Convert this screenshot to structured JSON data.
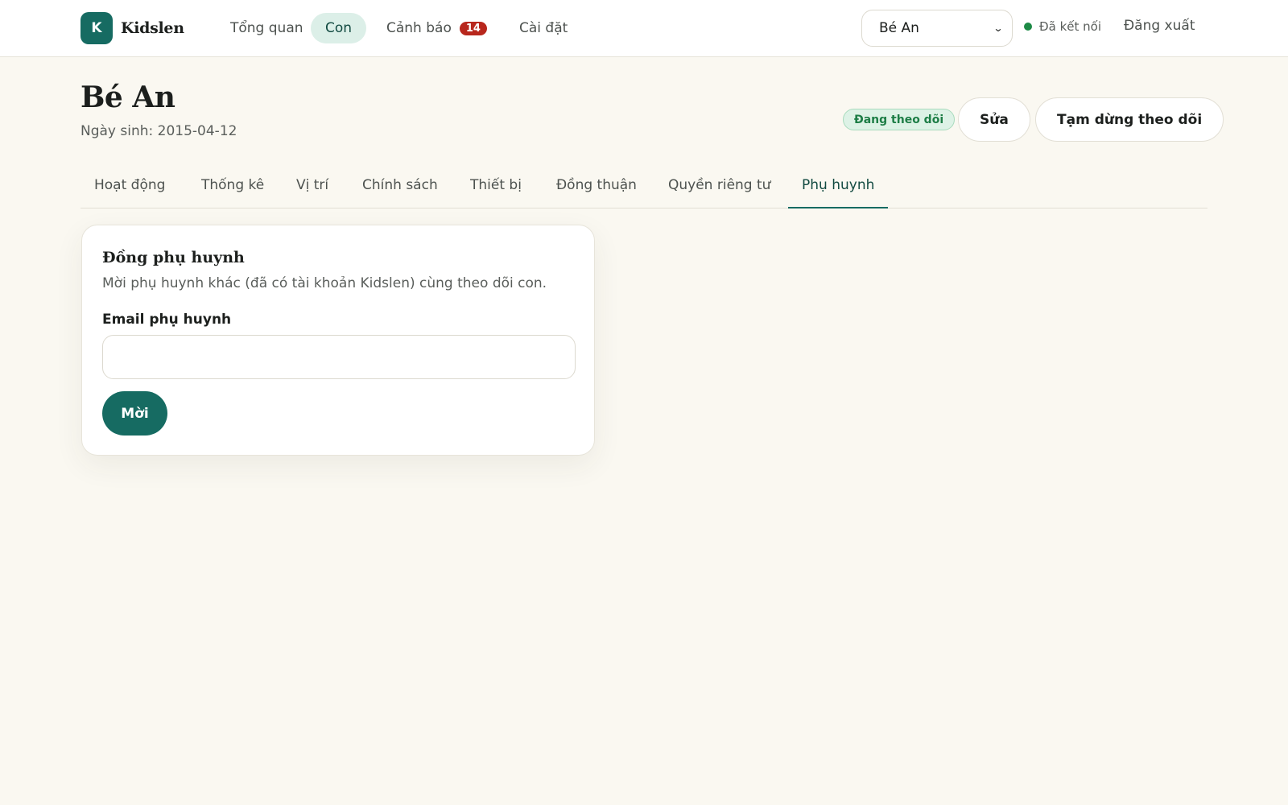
{
  "brand": {
    "letter": "K",
    "name": "Kidslen"
  },
  "nav": {
    "overview": "Tổng quan",
    "children": "Con",
    "alerts": "Cảnh báo",
    "alerts_count": "14",
    "settings": "Cài đặt",
    "active": "children"
  },
  "child_select": {
    "value": "Bé An"
  },
  "connection": {
    "label": "Đã kết nối",
    "color": "#1d8a46"
  },
  "logout": "Đăng xuất",
  "child": {
    "name": "Bé An",
    "dob": "Ngày sinh: 2015-04-12",
    "status": "Đang theo dõi"
  },
  "actions": {
    "edit": "Sửa",
    "pause": "Tạm dừng theo dõi"
  },
  "tabs": [
    {
      "label": "Hoạt động"
    },
    {
      "label": "Thống kê"
    },
    {
      "label": "Vị trí"
    },
    {
      "label": "Chính sách"
    },
    {
      "label": "Thiết bị"
    },
    {
      "label": "Đồng thuận"
    },
    {
      "label": "Quyền riêng tư"
    },
    {
      "label": "Phụ huynh"
    }
  ],
  "active_tab": "Phụ huynh",
  "coparent": {
    "title": "Đồng phụ huynh",
    "description": "Mời phụ huynh khác (đã có tài khoản Kidslen) cùng theo dõi con.",
    "email_label": "Email phụ huynh",
    "email_value": "",
    "email_placeholder": "",
    "invite_button": "Mời"
  },
  "colors": {
    "accent": "#166b62",
    "background": "#faf8f1",
    "alert_badge": "#b8271d",
    "status_green": "#1d7d46"
  }
}
